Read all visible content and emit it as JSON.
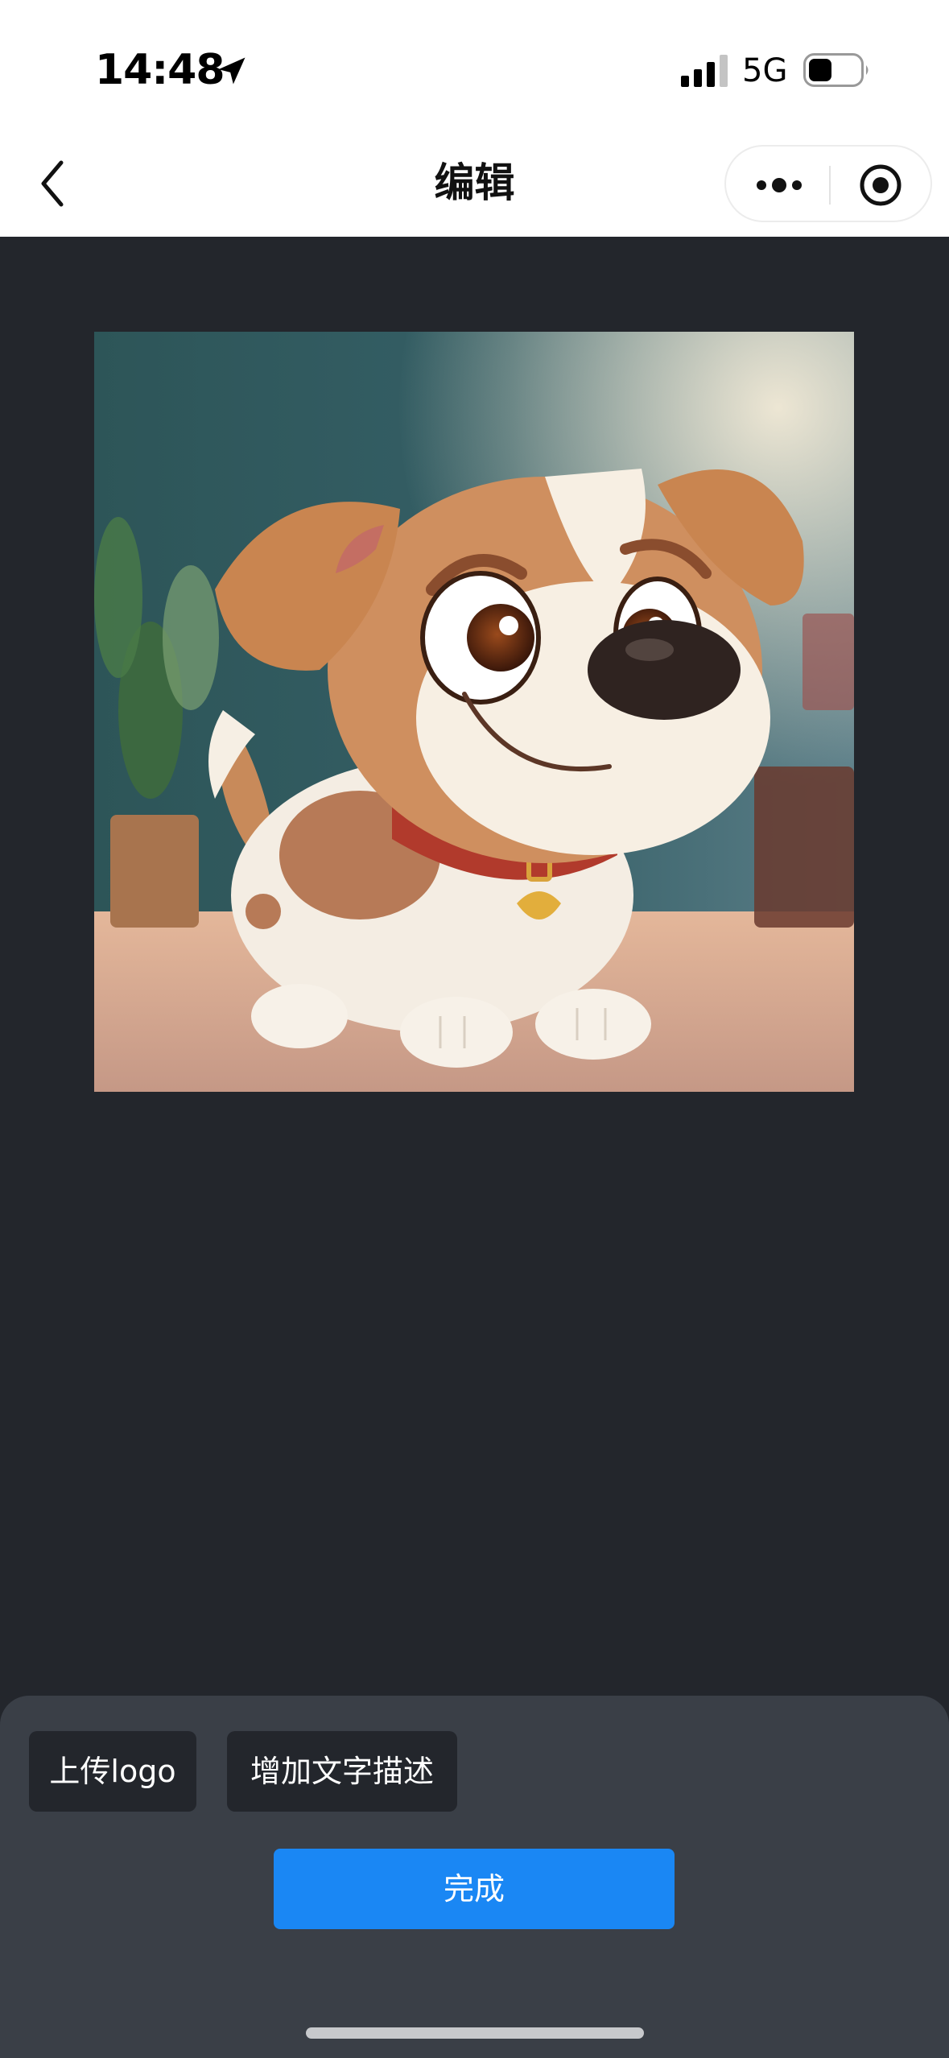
{
  "status_bar": {
    "time": "14:48",
    "network": "5G",
    "icons": [
      "location-arrow-icon",
      "signal-icon",
      "battery-icon"
    ]
  },
  "nav": {
    "title": "编辑",
    "icons": [
      "back-icon",
      "more-icon",
      "target-icon"
    ]
  },
  "preview": {
    "image": "cartoon puppy illustration"
  },
  "panel": {
    "upload_logo_label": "上传logo",
    "add_text_label": "增加文字描述",
    "done_label": "完成"
  },
  "colors": {
    "accent": "#1a87f4",
    "canvas_bg": "#23262c",
    "panel_bg": "#3a3f47",
    "chip_bg": "#23262c"
  }
}
